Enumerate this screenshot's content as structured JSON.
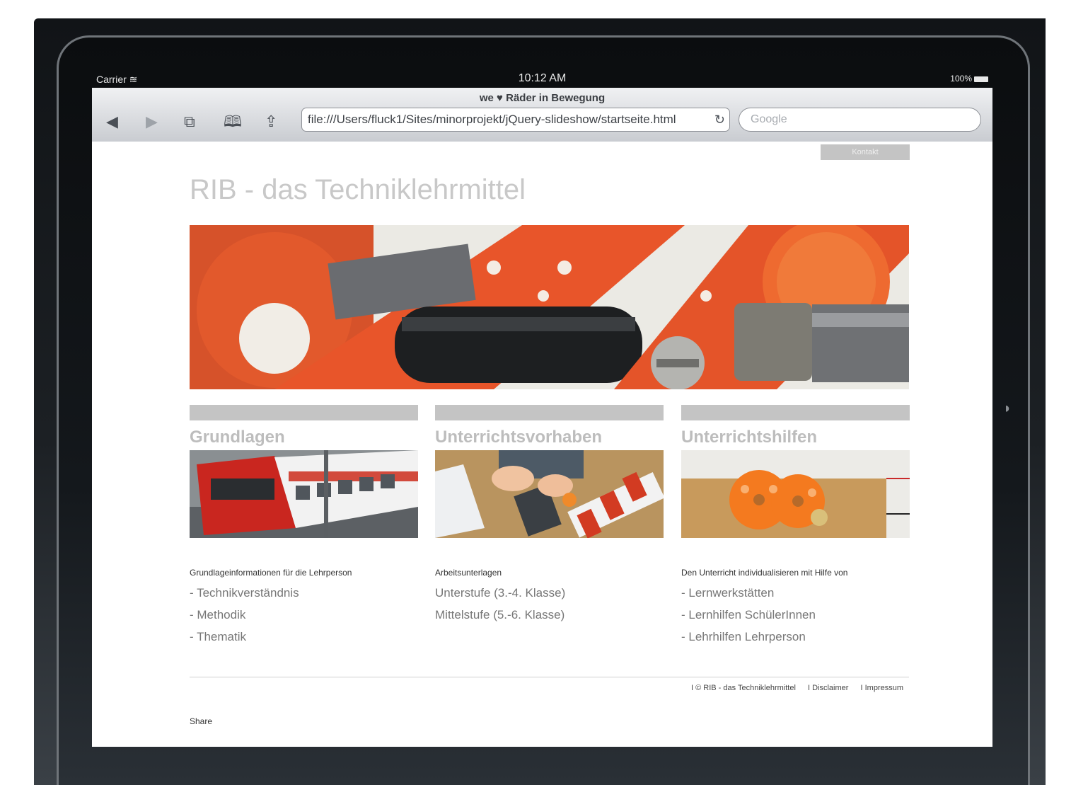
{
  "status_bar": {
    "carrier": "Carrier",
    "time": "10:12 AM",
    "battery": "100%"
  },
  "browser": {
    "page_title": "we ♥ Räder in Bewegung",
    "url": "file:///Users/fluck1/Sites/minorprojekt/jQuery-slideshow/startseite.html",
    "search_placeholder": "Google",
    "icons": [
      "back-icon",
      "forward-icon",
      "pages-icon",
      "bookmarks-icon",
      "share-icon",
      "reload-icon"
    ]
  },
  "site": {
    "contact_label": "Kontakt",
    "title": "RIB - das Techniklehrmittel",
    "columns": [
      {
        "heading": "Grundlagen",
        "intro": "Grundlageinformationen für die Lehrperson",
        "links": [
          "- Technikverständnis",
          "- Methodik",
          "- Thematik"
        ]
      },
      {
        "heading": "Unterrichtsvorhaben",
        "intro": "Arbeitsunterlagen",
        "links": [
          "Unterstufe (3.-4. Klasse)",
          "Mittelstufe (5.-6. Klasse)"
        ]
      },
      {
        "heading": "Unterrichtshilfen",
        "intro": "Den Unterricht individualisieren mit Hilfe von",
        "links": [
          "- Lernwerkstätten",
          "- Lernhilfen SchülerInnen",
          "- Lehrhilfen Lehrperson"
        ]
      }
    ],
    "footer": {
      "copyright": "I © RIB - das Techniklehrmittel",
      "disclaimer": "I Disclaimer",
      "impressum": "I Impressum"
    },
    "share_label": "Share"
  },
  "colors": {
    "device": "#14181c",
    "accent_orange": "#e8552a",
    "bar_gray": "#c4c4c4"
  }
}
